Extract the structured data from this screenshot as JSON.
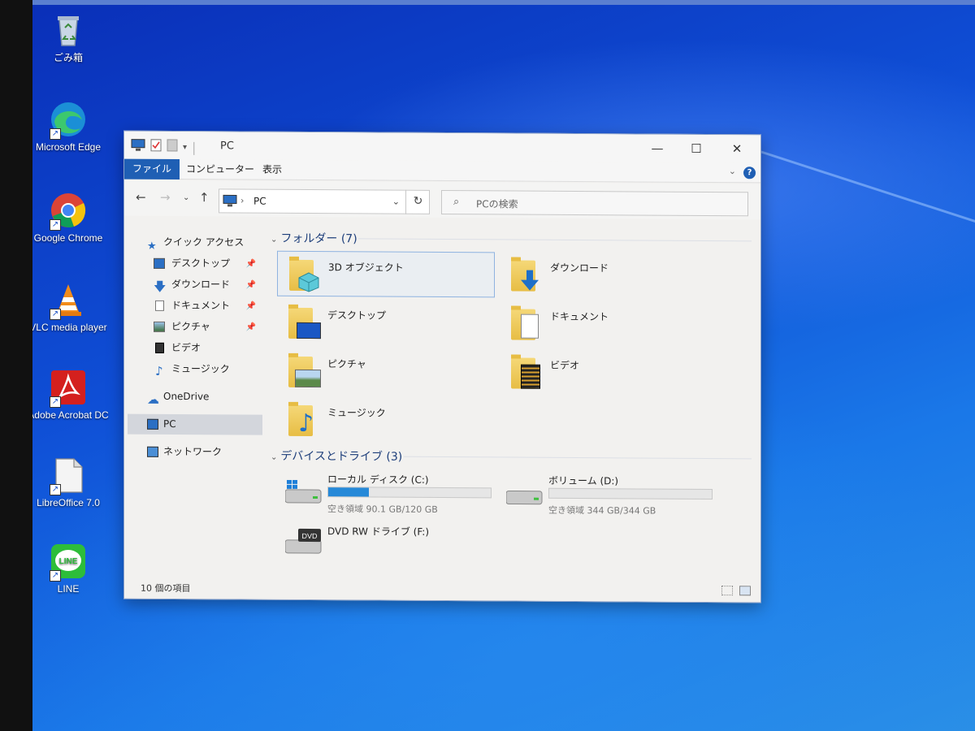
{
  "desktop": {
    "icons": [
      {
        "label": "ごみ箱",
        "icon": "recycle-bin-icon"
      },
      {
        "label": "Microsoft Edge",
        "icon": "edge-icon"
      },
      {
        "label": "Google Chrome",
        "icon": "chrome-icon"
      },
      {
        "label": "VLC media player",
        "icon": "vlc-icon"
      },
      {
        "label": "Adobe Acrobat DC",
        "icon": "acrobat-icon"
      },
      {
        "label": "LibreOffice 7.0",
        "icon": "libreoffice-icon"
      },
      {
        "label": "LINE",
        "icon": "line-icon"
      }
    ],
    "line_logo_text": "LINE"
  },
  "window": {
    "title": "PC",
    "controls": {
      "minimize": "—",
      "maximize": "☐",
      "close": "✕"
    },
    "ribbon_tabs": [
      "ファイル",
      "コンピューター",
      "表示"
    ],
    "help": "?",
    "address": {
      "path": "PC"
    },
    "search": {
      "placeholder": "PCの検索"
    },
    "sidebar": {
      "quick_access": "クイック アクセス",
      "items": [
        {
          "label": "デスクトップ",
          "pinned": true
        },
        {
          "label": "ダウンロード",
          "pinned": true
        },
        {
          "label": "ドキュメント",
          "pinned": true
        },
        {
          "label": "ピクチャ",
          "pinned": true
        },
        {
          "label": "ビデオ",
          "pinned": false
        },
        {
          "label": "ミュージック",
          "pinned": false
        }
      ],
      "onedrive": "OneDrive",
      "pc": "PC",
      "network": "ネットワーク"
    },
    "folders_group": "フォルダー (7)",
    "folders": [
      {
        "label": "3D オブジェクト"
      },
      {
        "label": "ダウンロード"
      },
      {
        "label": "デスクトップ"
      },
      {
        "label": "ドキュメント"
      },
      {
        "label": "ピクチャ"
      },
      {
        "label": "ビデオ"
      },
      {
        "label": "ミュージック"
      }
    ],
    "devices_group": "デバイスとドライブ (3)",
    "drives": [
      {
        "label": "ローカル ディスク (C:)",
        "free": "空き領域 90.1 GB/120 GB",
        "used_fraction": 0.25
      },
      {
        "label": "ボリューム (D:)",
        "free": "空き領域 344 GB/344 GB",
        "used_fraction": 0.0
      },
      {
        "label": "DVD RW ドライブ (F:)",
        "badge": "DVD"
      }
    ],
    "status": "10 個の項目"
  },
  "colors": {
    "accent": "#1f5fb4",
    "drive_bar": "#2689d8",
    "folder": "#e7bd44"
  }
}
